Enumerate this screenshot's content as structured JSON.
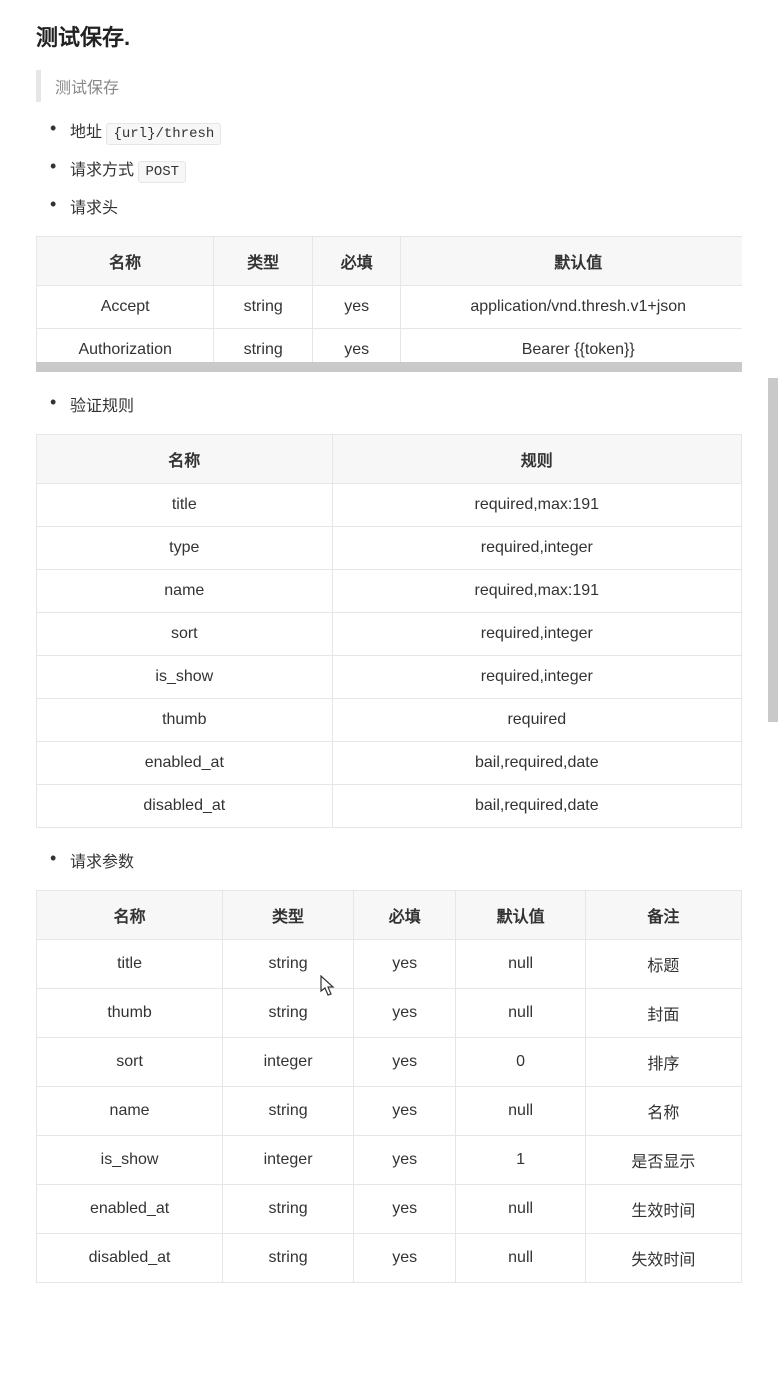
{
  "heading": "测试保存.",
  "quote": "测试保存",
  "meta": {
    "addr_label": "地址",
    "addr_code": "{url}/thresh",
    "method_label": "请求方式",
    "method_code": "POST",
    "headers_label": "请求头",
    "rules_label": "验证规则",
    "params_label": "请求参数"
  },
  "headers_table": {
    "cols": [
      "名称",
      "类型",
      "必填",
      "默认值"
    ],
    "rows": [
      [
        "Accept",
        "string",
        "yes",
        "application/vnd.thresh.v1+json"
      ],
      [
        "Authorization",
        "string",
        "yes",
        "Bearer {{token}}"
      ]
    ]
  },
  "rules_table": {
    "cols": [
      "名称",
      "规则"
    ],
    "rows": [
      [
        "title",
        "required,max:191"
      ],
      [
        "type",
        "required,integer"
      ],
      [
        "name",
        "required,max:191"
      ],
      [
        "sort",
        "required,integer"
      ],
      [
        "is_show",
        "required,integer"
      ],
      [
        "thumb",
        "required"
      ],
      [
        "enabled_at",
        "bail,required,date"
      ],
      [
        "disabled_at",
        "bail,required,date"
      ]
    ]
  },
  "params_table": {
    "cols": [
      "名称",
      "类型",
      "必填",
      "默认值",
      "备注"
    ],
    "rows": [
      [
        "title",
        "string",
        "yes",
        "null",
        "标题"
      ],
      [
        "thumb",
        "string",
        "yes",
        "null",
        "封面"
      ],
      [
        "sort",
        "integer",
        "yes",
        "0",
        "排序"
      ],
      [
        "name",
        "string",
        "yes",
        "null",
        "名称"
      ],
      [
        "is_show",
        "integer",
        "yes",
        "1",
        "是否显示"
      ],
      [
        "enabled_at",
        "string",
        "yes",
        "null",
        "生效时间"
      ],
      [
        "disabled_at",
        "string",
        "yes",
        "null",
        "失效时间"
      ]
    ]
  }
}
